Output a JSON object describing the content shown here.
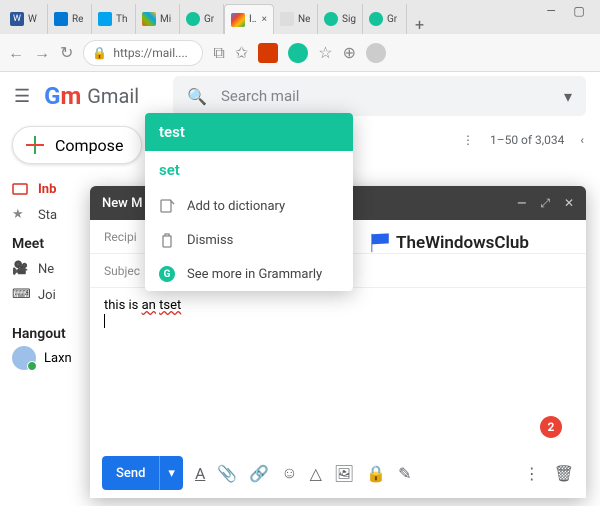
{
  "browser": {
    "tabs": [
      {
        "label": "W",
        "color": "#2b579a"
      },
      {
        "label": "Re",
        "color": "#0078d4"
      },
      {
        "label": "Th",
        "color": "#00a4ef"
      },
      {
        "label": "Mi",
        "color": "#737373"
      },
      {
        "label": "Gr",
        "color": "#15c39a"
      },
      {
        "label": "Inb",
        "color": "#ea4335",
        "active": true
      },
      {
        "label": "Ne",
        "color": "#888"
      },
      {
        "label": "Sig",
        "color": "#15c39a"
      },
      {
        "label": "Gr",
        "color": "#15c39a"
      }
    ],
    "url": "https://mail....",
    "ext_office": "#d83b01",
    "ext_grammarly": "#15c39a"
  },
  "gmail": {
    "brand": "Gmail",
    "search_placeholder": "Search mail",
    "compose_label": "Compose",
    "nav": [
      {
        "label": "Inb",
        "active": true
      },
      {
        "label": "Sta"
      }
    ],
    "meet_header": "Meet",
    "meet_items": [
      {
        "label": "Ne"
      },
      {
        "label": "Joi"
      }
    ],
    "hangouts_header": "Hangout",
    "hangouts_user": "Laxn",
    "toolbar_count": "1–50 of 3,034"
  },
  "compose": {
    "window_title": "New M",
    "recipients_label": "Recipi",
    "subject_label": "Subjec",
    "body_prefix": "this is ",
    "body_err1": "an",
    "body_err2": "tset",
    "send_label": "Send"
  },
  "grammarly": {
    "header": "test",
    "suggestion": "set",
    "add_dict": "Add to dictionary",
    "dismiss": "Dismiss",
    "see_more": "See more in Grammarly",
    "badge_count": "2"
  },
  "twc_label": "TheWindowsClub"
}
